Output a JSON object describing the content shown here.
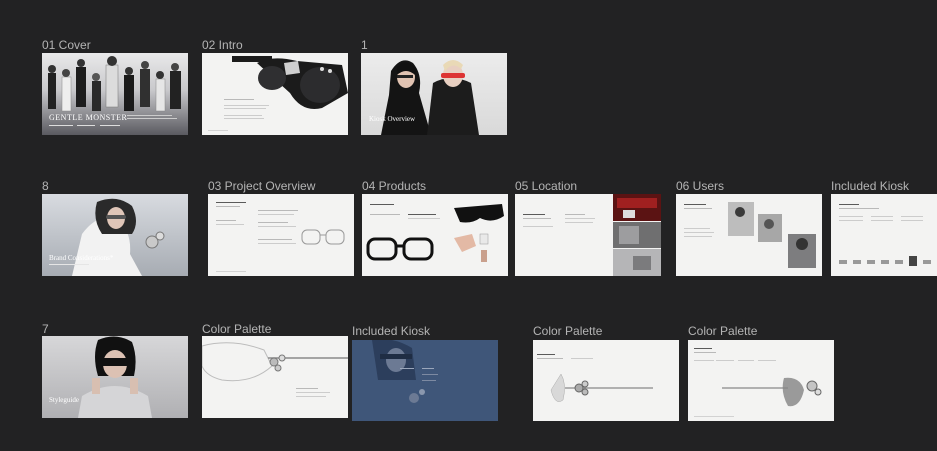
{
  "frames": [
    {
      "label": "01 Cover"
    },
    {
      "label": "02 Intro"
    },
    {
      "label": "1"
    },
    {
      "label": "8"
    },
    {
      "label": "03 Project Overview"
    },
    {
      "label": "04 Products"
    },
    {
      "label": "05 Location"
    },
    {
      "label": "06 Users"
    },
    {
      "label": "Included Kiosk"
    },
    {
      "label": "7"
    },
    {
      "label": "Color Palette"
    },
    {
      "label": "Included Kiosk"
    },
    {
      "label": "Color Palette"
    },
    {
      "label": "Color Palette"
    }
  ],
  "slides": {
    "cover_title": "GENTLE MONSTER",
    "kiosk_overview": "Kiosk Overview",
    "brand_considerations": "Brand Considerations*",
    "styleguide": "Styleguide"
  },
  "colors": {
    "canvas_bg": "#222223",
    "label_text": "#b4b4b4",
    "slide_light": "#f3f3f2",
    "kiosk_blue": "#3f5679"
  }
}
